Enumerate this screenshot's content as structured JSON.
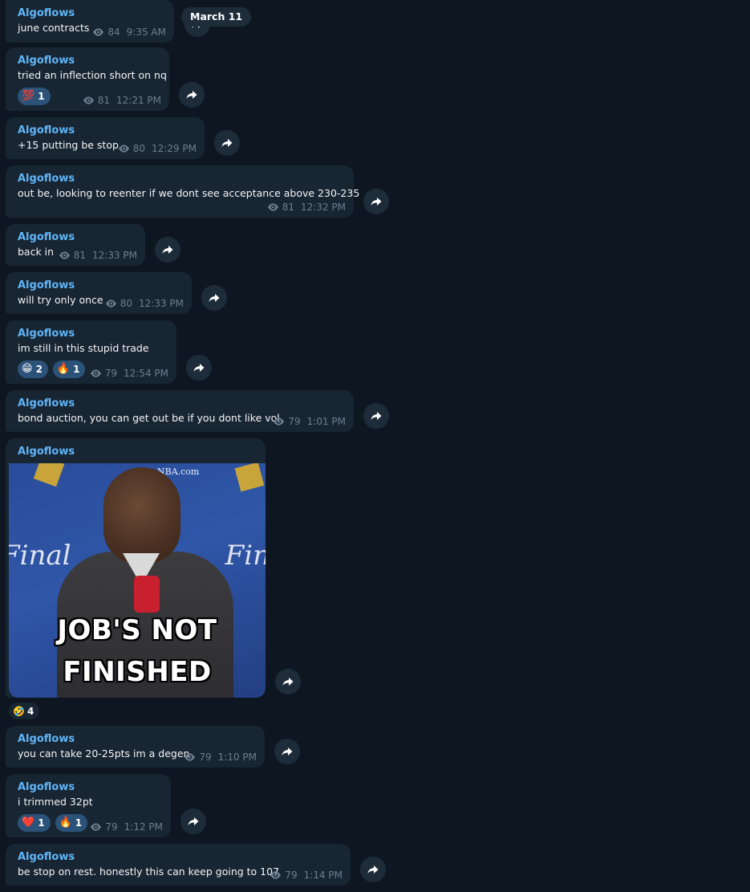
{
  "date_separator": "March 11",
  "messages": [
    {
      "sender": "Algoflows",
      "text": "june contracts",
      "views": "84",
      "time": "9:35 AM"
    },
    {
      "sender": "Algoflows",
      "text": "tried an inflection short on nq",
      "views": "81",
      "time": "12:21 PM",
      "reactions": [
        {
          "emoji": "💯",
          "count": "1"
        }
      ]
    },
    {
      "sender": "Algoflows",
      "text": "+15 putting be stop",
      "views": "80",
      "time": "12:29 PM"
    },
    {
      "sender": "Algoflows",
      "text": "out be, looking to reenter if we dont see acceptance above 230-235",
      "views": "81",
      "time": "12:32 PM"
    },
    {
      "sender": "Algoflows",
      "text": "back in",
      "views": "81",
      "time": "12:33 PM"
    },
    {
      "sender": "Algoflows",
      "text": "will try only once",
      "views": "80",
      "time": "12:33 PM"
    },
    {
      "sender": "Algoflows",
      "text": "im still in this stupid trade",
      "views": "79",
      "time": "12:54 PM",
      "reactions": [
        {
          "emoji": "😁",
          "count": "2"
        },
        {
          "emoji": "🔥",
          "count": "1"
        }
      ]
    },
    {
      "sender": "Algoflows",
      "text": "bond auction, you can get out be if you dont like vol",
      "views": "79",
      "time": "1:01 PM"
    },
    {
      "sender": "Algoflows",
      "media_caption_line1": "JOB'S NOT",
      "media_caption_line2": "FINISHED",
      "media_bg_text_left": "Final",
      "media_bg_text_right": "Fin",
      "media_top_text": "NBA.com",
      "reactions": [
        {
          "emoji": "🤣",
          "count": "4"
        }
      ]
    },
    {
      "sender": "Algoflows",
      "text": "you can take 20-25pts im a degen",
      "views": "79",
      "time": "1:10 PM"
    },
    {
      "sender": "Algoflows",
      "text": "i trimmed 32pt",
      "views": "79",
      "time": "1:12 PM",
      "reactions": [
        {
          "emoji": "❤️",
          "count": "1"
        },
        {
          "emoji": "🔥",
          "count": "1"
        }
      ]
    },
    {
      "sender": "Algoflows",
      "text": "be stop on rest. honestly this can keep going to 107",
      "views": "79",
      "time": "1:14 PM"
    }
  ],
  "icons": {
    "views": "eye-icon",
    "share": "share-arrow-icon"
  },
  "colors": {
    "background": "#0e1621",
    "bubble": "#182533",
    "sender": "#5eb5f7",
    "meta": "#6d7f8f",
    "reaction": "#2b5278"
  }
}
